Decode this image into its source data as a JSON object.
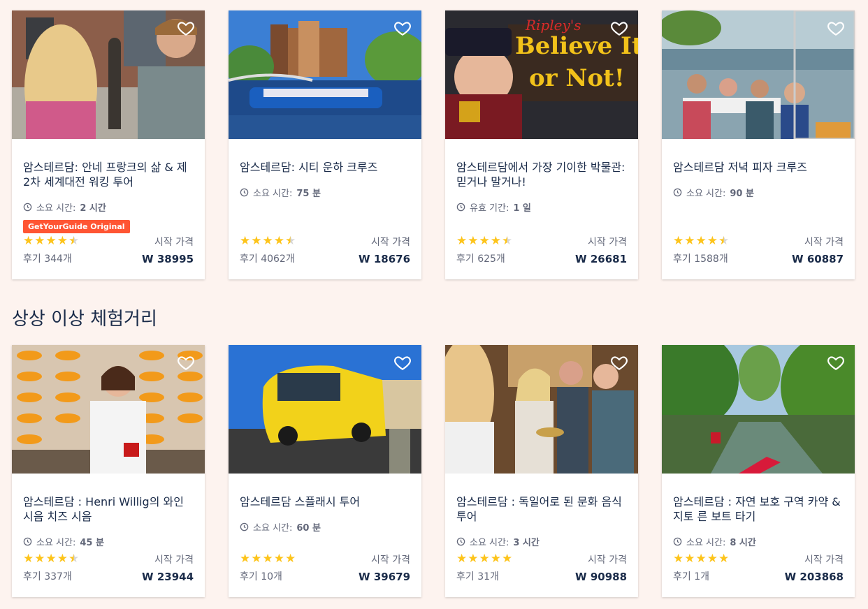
{
  "section2_title": "상상 이상 체험거리",
  "cards_row1": [
    {
      "title": "암스테르담: 안네 프랑크의 삶 & 제2차 세계대전 워킹 투어",
      "duration_label": "소요 시간:",
      "duration_value": "2 시간",
      "badge": "GetYourGuide Original",
      "rating": 4.5,
      "reviews": "후기 344개",
      "from_label": "시작 가격",
      "price": "W 38995"
    },
    {
      "title": "암스테르담: 시티 운하 크루즈",
      "duration_label": "소요 시간:",
      "duration_value": "75 분",
      "rating": 4.5,
      "reviews": "후기 4062개",
      "from_label": "시작 가격",
      "price": "W 18676"
    },
    {
      "title": "암스테르담에서 가장 기이한 박물관: 믿거나 말거나!",
      "duration_label": "유효 기간:",
      "duration_value": "1 일",
      "rating": 4.5,
      "reviews": "후기 625개",
      "from_label": "시작 가격",
      "price": "W 26681"
    },
    {
      "title": "암스테르담 저녁 피자 크루즈",
      "duration_label": "소요 시간:",
      "duration_value": "90 분",
      "rating": 4.5,
      "reviews": "후기 1588개",
      "from_label": "시작 가격",
      "price": "W 60887"
    }
  ],
  "cards_row2": [
    {
      "title": "암스테르담 : Henri Willig의 와인 시음 치즈 시음",
      "duration_label": "소요 시간:",
      "duration_value": "45 분",
      "rating": 4.5,
      "reviews": "후기 337개",
      "from_label": "시작 가격",
      "price": "W 23944"
    },
    {
      "title": "암스테르담 스플래시 투어",
      "duration_label": "소요 시간:",
      "duration_value": "60 분",
      "rating": 5,
      "reviews": "후기 10개",
      "from_label": "시작 가격",
      "price": "W 39679"
    },
    {
      "title": "암스테르담 : 독일어로 된 문화 음식 투어",
      "duration_label": "소요 시간:",
      "duration_value": "3 시간",
      "rating": 5,
      "reviews": "후기 31개",
      "from_label": "시작 가격",
      "price": "W 90988"
    },
    {
      "title": "암스테르담 : 자연 보호 구역 카약 & 지토 른 보트 타기",
      "duration_label": "소요 시간:",
      "duration_value": "8 시간",
      "rating": 5,
      "reviews": "후기 1개",
      "from_label": "시작 가격",
      "price": "W 203868"
    }
  ],
  "icons": {
    "heart": "heart-icon",
    "clock": "clock-icon",
    "star": "star-icon"
  },
  "colors": {
    "background": "#fdf3ef",
    "badge": "#ff5533",
    "star": "#fdc41b",
    "text": "#1a2b49"
  }
}
